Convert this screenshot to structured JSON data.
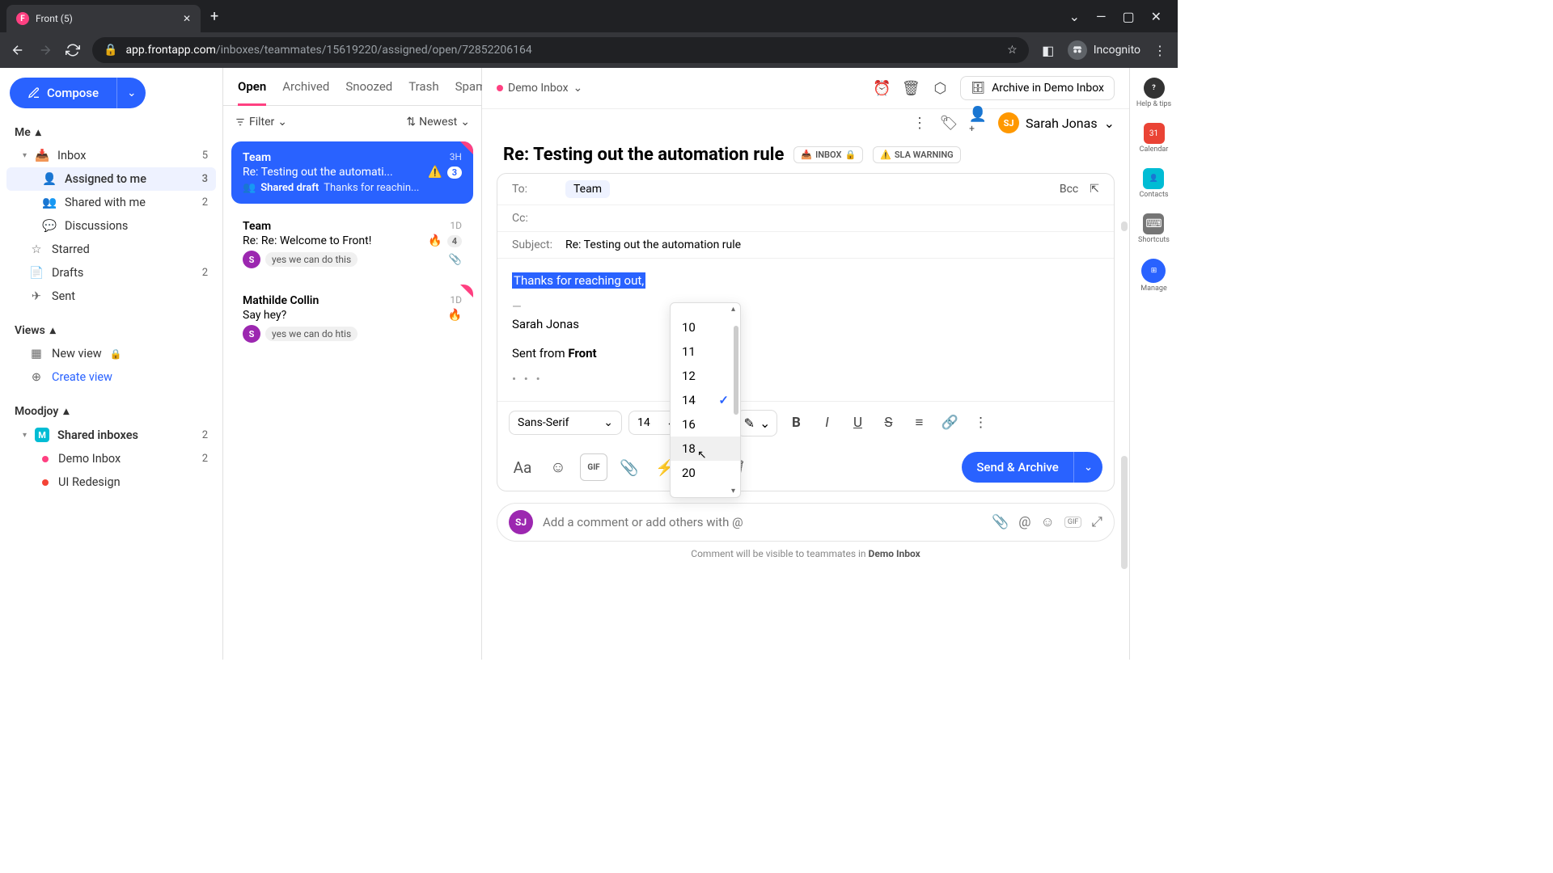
{
  "browser": {
    "tab_title": "Front (5)",
    "url_domain": "app.frontapp.com",
    "url_path": "/inboxes/teammates/15619220/assigned/open/72852206164",
    "incognito_label": "Incognito"
  },
  "sidebar": {
    "compose_label": "Compose",
    "sections": {
      "me": "Me",
      "views": "Views",
      "moodjoy": "Moodjoy"
    },
    "items": {
      "inbox": {
        "label": "Inbox",
        "count": "5"
      },
      "assigned": {
        "label": "Assigned to me",
        "count": "3"
      },
      "shared": {
        "label": "Shared with me",
        "count": "2"
      },
      "discussions": {
        "label": "Discussions"
      },
      "starred": {
        "label": "Starred"
      },
      "drafts": {
        "label": "Drafts",
        "count": "2"
      },
      "sent": {
        "label": "Sent"
      },
      "new_view": {
        "label": "New view"
      },
      "create_view": {
        "label": "Create view"
      },
      "shared_inboxes": {
        "label": "Shared inboxes",
        "count": "2"
      },
      "demo_inbox": {
        "label": "Demo Inbox",
        "count": "2"
      },
      "ui_redesign": {
        "label": "UI Redesign"
      }
    }
  },
  "convo_tabs": {
    "open": "Open",
    "archived": "Archived",
    "snoozed": "Snoozed",
    "trash": "Trash",
    "spam": "Spam"
  },
  "convo_controls": {
    "filter": "Filter",
    "sort": "Newest"
  },
  "conversations": [
    {
      "name": "Team",
      "time": "3H",
      "subject": "Re: Testing out the automati...",
      "warn": "⚠️",
      "badge": "3",
      "draft_label": "Shared draft",
      "draft_text": "Thanks for reachin..."
    },
    {
      "name": "Team",
      "time": "1D",
      "subject": "Re: Re: Welcome to Front!",
      "fire": "🔥",
      "badge": "4",
      "avatar": "S",
      "chip": "yes we can do this",
      "attach": true
    },
    {
      "name": "Mathilde Collin",
      "time": "1D",
      "subject": "Say hey?",
      "fire": "🔥",
      "avatar": "S",
      "chip": "yes we can do htis"
    }
  ],
  "main": {
    "inbox_chip": "Demo Inbox",
    "archive_label": "Archive in Demo Inbox",
    "assignee": {
      "initials": "SJ",
      "name": "Sarah Jonas"
    },
    "title": "Re: Testing out the automation rule",
    "tags": {
      "inbox": "INBOX",
      "sla": "SLA WARNING"
    },
    "fields": {
      "to_label": "To:",
      "to_value": "Team",
      "cc_label": "Cc:",
      "bcc_label": "Bcc",
      "subject_label": "Subject:",
      "subject_value": "Re: Testing out the automation rule"
    },
    "body": {
      "highlighted": "Thanks for reaching out,",
      "sep": "—",
      "signature": "Sarah Jonas",
      "sent_prefix": "Sent from ",
      "sent_app": "Front",
      "dots": "• • •"
    },
    "font_sizes": [
      "10",
      "11",
      "12",
      "14",
      "16",
      "18",
      "20"
    ],
    "font_size_selected": "14",
    "toolbar": {
      "font_family": "Sans-Serif",
      "font_size": "14"
    },
    "send_label": "Send & Archive",
    "comment_placeholder": "Add a comment or add others with @",
    "comment_hint_prefix": "Comment will be visible to teammates in ",
    "comment_hint_inbox": "Demo Inbox"
  },
  "rail": {
    "help": "Help & tips",
    "calendar": "Calendar",
    "contacts": "Contacts",
    "shortcuts": "Shortcuts",
    "manage": "Manage"
  }
}
